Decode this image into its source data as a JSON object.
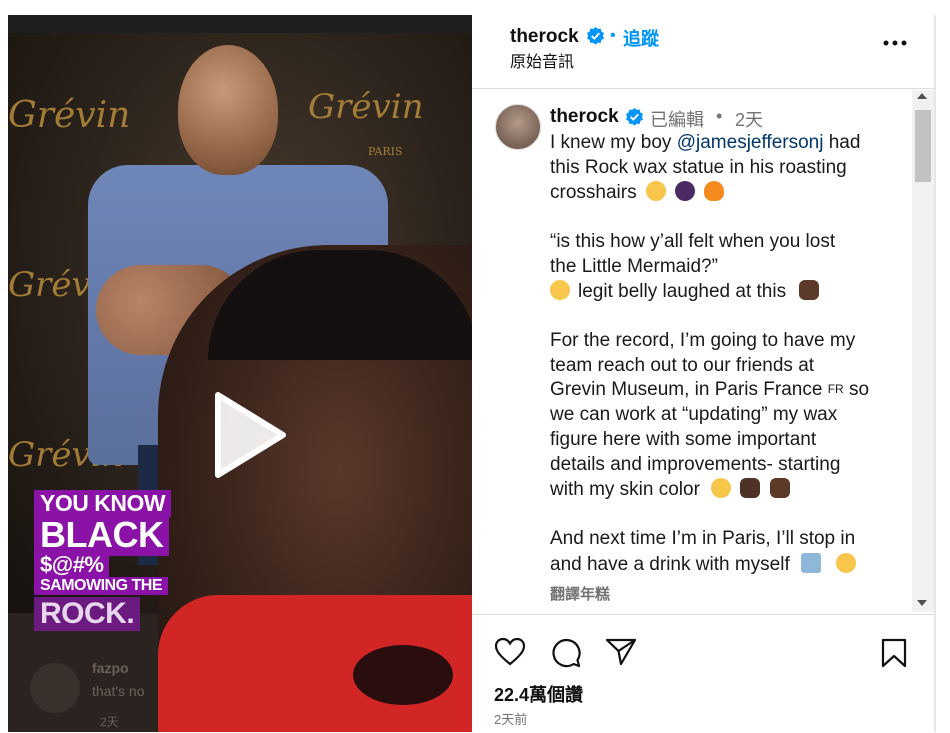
{
  "video": {
    "caption_lines": [
      "YOU KNOW",
      "BLACK",
      "$@#%",
      "SAMOWING THE",
      "ROCK."
    ],
    "backdrop_brand": "Grévin",
    "backdrop_sub": "PARIS",
    "ghost_user": "fazpo",
    "ghost_comment": "that's no",
    "ghost_time": "2天"
  },
  "header": {
    "username": "therock",
    "verified": true,
    "follow_label": "追蹤",
    "separator": "•",
    "audio_label": "原始音訊",
    "more_icon": "more-horizontal-icon"
  },
  "post": {
    "username": "therock",
    "edited_label": "已編輯",
    "dot": "•",
    "time": "2天",
    "caption_lines": [
      {
        "pre": "I knew my boy ",
        "mention": "@jamesjeffersonj",
        "post": " had"
      },
      {
        "text": "this Rock wax statue in his roasting"
      },
      {
        "text": "crosshairs"
      },
      {
        "text": "“is this how y’all felt when you lost"
      },
      {
        "text": "the Little Mermaid?”"
      },
      {
        "text": "legit belly laughed at this"
      },
      {
        "text": "For the record, I’m going to have my"
      },
      {
        "text": "team reach out to our friends at"
      },
      {
        "pre": "Grevin Museum, in Paris France ",
        "flag": "FR",
        "post": " so"
      },
      {
        "text": "we can work at “updating” my wax"
      },
      {
        "text": "figure here with some important"
      },
      {
        "text": "details and improvements- starting"
      },
      {
        "text": "with my skin color"
      },
      {
        "text": "And next time I’m in Paris, I’ll stop in"
      },
      {
        "text": "and have a drink with myself"
      }
    ],
    "see_translation": "翻譯年糕"
  },
  "actions": {
    "like_icon": "heart-icon",
    "comment_icon": "comment-icon",
    "share_icon": "send-icon",
    "save_icon": "bookmark-icon",
    "likes_text": "22.4萬個讚",
    "timestamp": "2天前"
  },
  "colors": {
    "verified_blue": "#0095f6",
    "follow_blue": "#0095f6",
    "mention_blue": "#00376b",
    "caption_purple": "#8a12a6"
  }
}
